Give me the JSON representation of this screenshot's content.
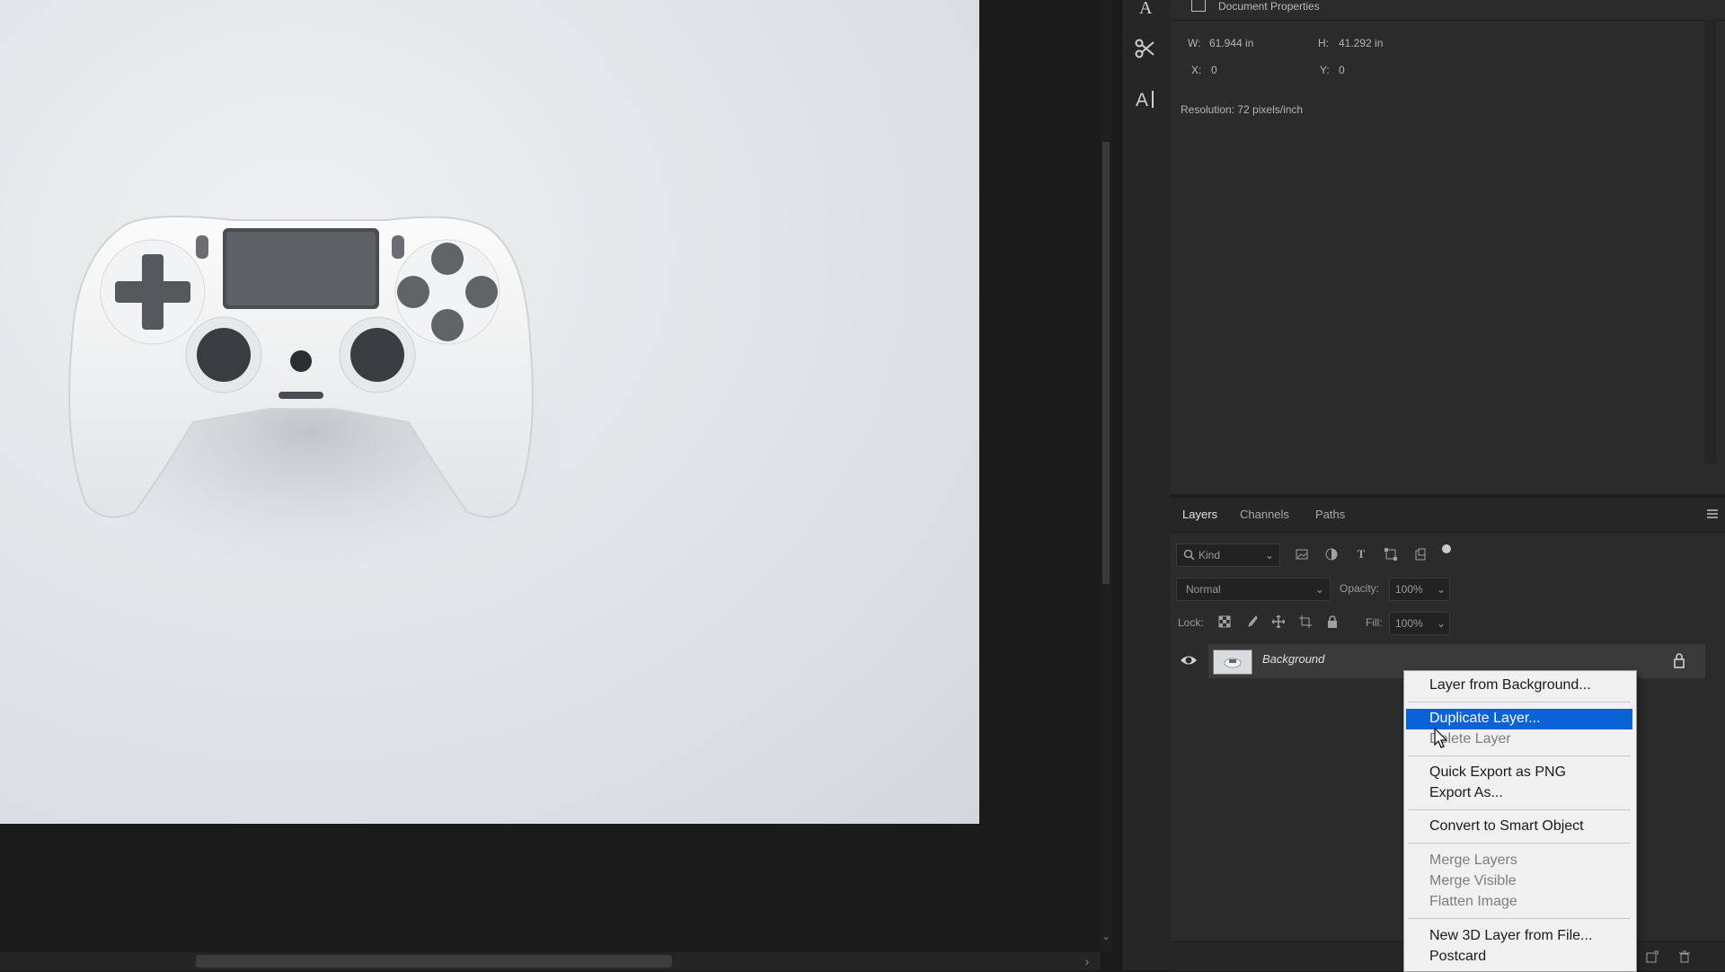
{
  "canvas": {
    "photo_alt": "Photo of a white game controller on a light grey background"
  },
  "properties": {
    "title": "Document Properties",
    "w_label": "W:",
    "w_value": "61.944 in",
    "h_label": "H:",
    "h_value": "41.292 in",
    "x_label": "X:",
    "x_value": "0",
    "y_label": "Y:",
    "y_value": "0",
    "resolution": "Resolution: 72 pixels/inch"
  },
  "layers_panel": {
    "tabs": [
      "Layers",
      "Channels",
      "Paths"
    ],
    "active_tab": "Layers",
    "filter_kind": "Kind",
    "blend_mode": "Normal",
    "opacity_label": "Opacity:",
    "opacity_value": "100%",
    "lock_label": "Lock:",
    "fill_label": "Fill:",
    "fill_value": "100%",
    "layers": [
      {
        "name": "Background",
        "visible": true,
        "locked": true
      }
    ]
  },
  "context_menu": {
    "items": [
      {
        "label": "Layer from Background...",
        "enabled": true
      },
      {
        "label": "Duplicate Layer...",
        "enabled": true,
        "highlighted": true
      },
      {
        "label": "Delete Layer",
        "enabled": false
      },
      {
        "label": "Quick Export as PNG",
        "enabled": true
      },
      {
        "label": "Export As...",
        "enabled": true
      },
      {
        "label": "Convert to Smart Object",
        "enabled": true
      },
      {
        "label": "Merge Layers",
        "enabled": false
      },
      {
        "label": "Merge Visible",
        "enabled": false
      },
      {
        "label": "Flatten Image",
        "enabled": false
      },
      {
        "label": "New 3D Layer from File...",
        "enabled": true
      },
      {
        "label": "Postcard",
        "enabled": true
      }
    ]
  },
  "colors": {
    "highlight": "#0a63d6",
    "panel_bg": "#2b2b2b",
    "app_bg": "#1b1b1b"
  }
}
